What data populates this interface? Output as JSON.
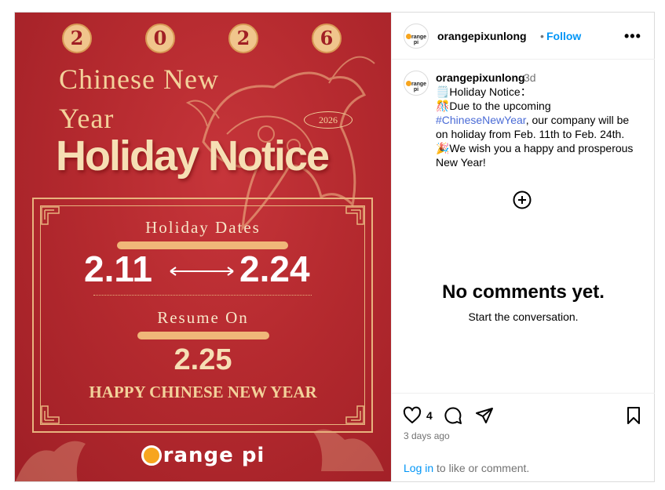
{
  "poster": {
    "year_digits": [
      "2",
      "0",
      "2",
      "6"
    ],
    "title_line1": "Chinese New",
    "title_line2": "Year",
    "year_badge": "2026",
    "headline": "Holiday Notice",
    "holiday_dates_label": "Holiday Dates",
    "date_start": "2.11",
    "date_end": "2.24",
    "resume_label": "Resume On",
    "resume_date": "2.25",
    "greeting": "HAPPY CHINESE NEW YEAR",
    "logo_text": "range pi",
    "colors": {
      "background": "#b52a2f",
      "gold": "#f3d29b",
      "accent_bar": "#f0b779"
    }
  },
  "post": {
    "header": {
      "username": "orangepixunlong",
      "separator": "•",
      "follow_label": "Follow",
      "more_icon": "more-options-icon",
      "avatar_text": "range pi"
    },
    "caption": {
      "username": "orangepixunlong",
      "age": "3d",
      "line1": "🗒️Holiday Notice：",
      "line2_prefix": "🎊Due to the upcoming ",
      "hashtag": "#ChineseNewYear",
      "line2_suffix": ", our company will be on holiday from Feb. 11th to Feb. 24th.",
      "line3": "🎉We wish you a happy and prosperous New Year!"
    },
    "comments": {
      "empty_title": "No comments yet.",
      "empty_subtitle": "Start the conversation."
    },
    "actions": {
      "like_count": "4",
      "posted_ago": "3 days ago",
      "login_link": "Log in",
      "login_suffix": " to like or comment."
    }
  }
}
